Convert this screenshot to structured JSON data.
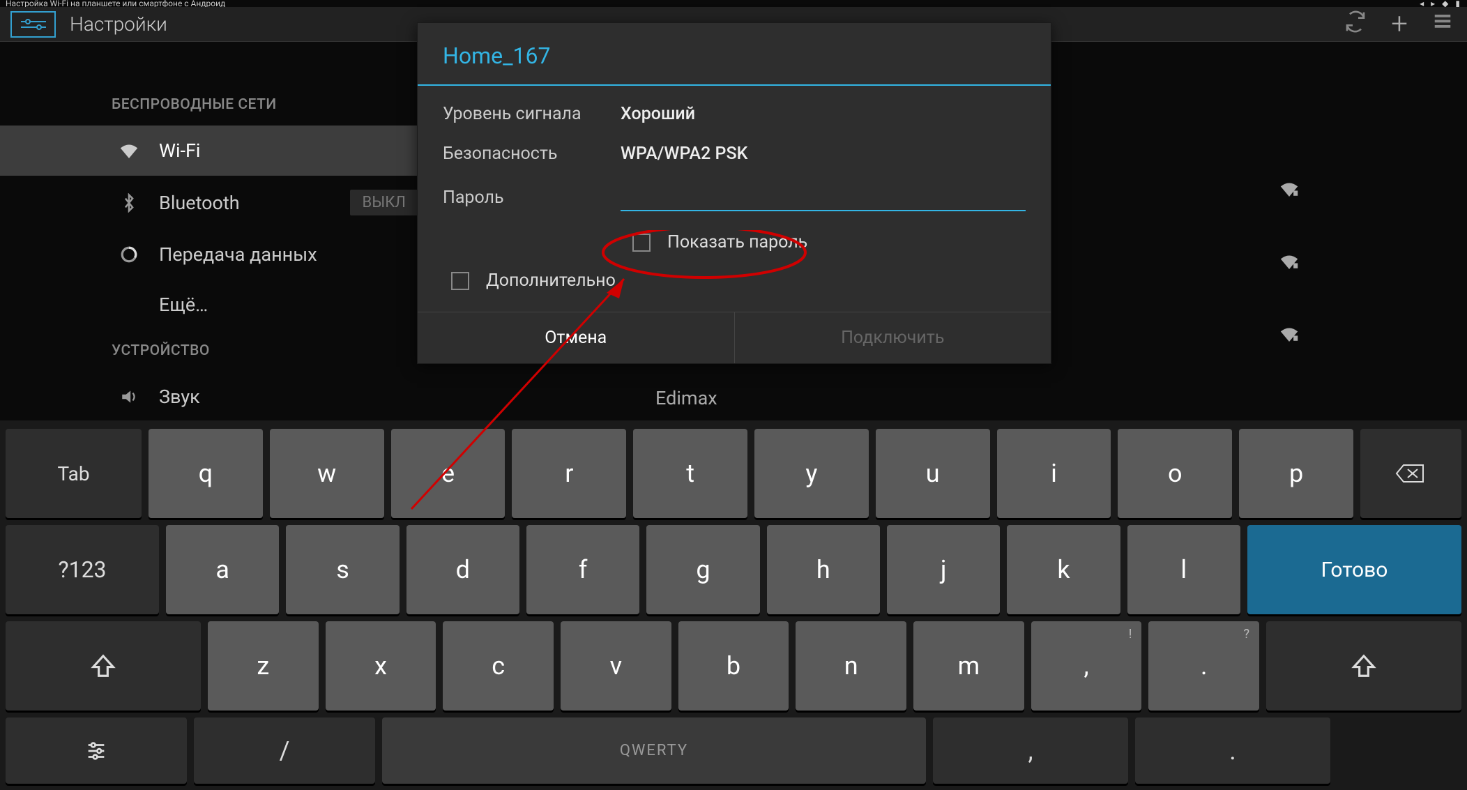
{
  "caption": "Настройка Wi-Fi на планшете или смартфоне с Андроид",
  "header": {
    "title": "Настройки"
  },
  "sidebar": {
    "section_wireless": "БЕСПРОВОДНЫЕ СЕТИ",
    "wifi": "Wi-Fi",
    "bluetooth": "Bluetooth",
    "bt_off": "ВЫКЛ",
    "data": "Передача данных",
    "more": "Ещё…",
    "section_device": "УСТРОЙСТВО",
    "sound": "Звук"
  },
  "wifi_behind": "Edimax",
  "dialog": {
    "title": "Home_167",
    "signal_label": "Уровень сигнала",
    "signal_value": "Хороший",
    "security_label": "Безопасность",
    "security_value": "WPA/WPA2 PSK",
    "password_label": "Пароль",
    "password_value": "",
    "show_password": "Показать пароль",
    "advanced": "Дополнительно",
    "cancel": "Отмена",
    "connect": "Подключить"
  },
  "keyboard": {
    "tab": "Tab",
    "row1": [
      "q",
      "w",
      "e",
      "r",
      "t",
      "y",
      "u",
      "i",
      "o",
      "p"
    ],
    "bksp": "⌫",
    "numsw": "?123",
    "row2": [
      "a",
      "s",
      "d",
      "f",
      "g",
      "h",
      "j",
      "k",
      "l"
    ],
    "done": "Готово",
    "row3": [
      "z",
      "x",
      "c",
      "v",
      "b",
      "n",
      "m"
    ],
    "comma": ",",
    "comma_sup": "!",
    "dot": ".",
    "dot_sup": "?",
    "slash": "/",
    "space": "QWERTY",
    "comma2": ",",
    "dot2": "."
  },
  "colors": {
    "accent": "#33b5e5"
  }
}
